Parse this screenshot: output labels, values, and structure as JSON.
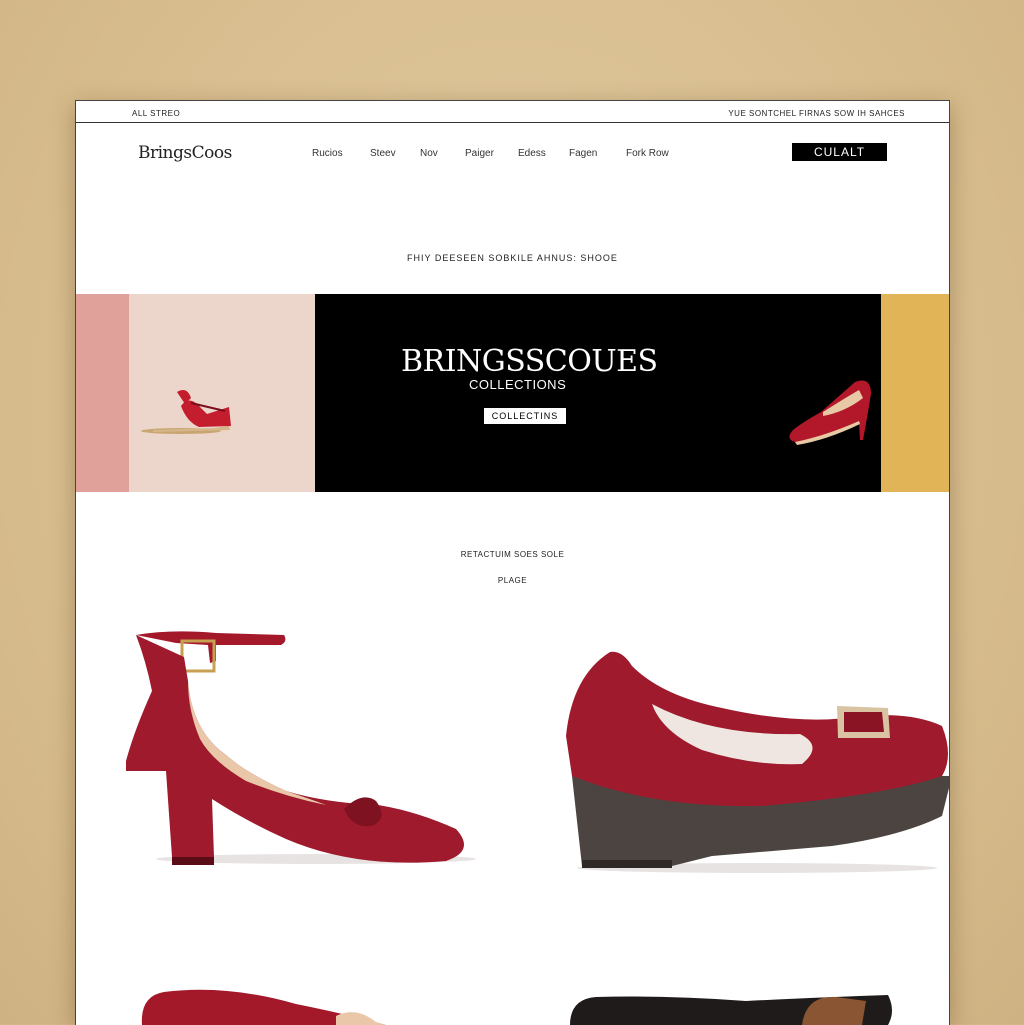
{
  "topbar": {
    "left_text": "ALL STREO",
    "right_text": "YUE SONTCHEL FIRNAS SOW IH SAHCES"
  },
  "header": {
    "logo": "BringsCoos",
    "nav": [
      "Rucios",
      "Steev",
      "Nov",
      "Paiger",
      "Edess",
      "Fagen",
      "Fork Row"
    ],
    "cta_label": "CULALT"
  },
  "tagline": "FHIY DEESEEN SOBKILE AHNUS: SHOOE",
  "hero": {
    "title": "BRINGSSCOUES",
    "subtitle": "COLLECTIONS",
    "button_label": "COLLECTINS"
  },
  "section": {
    "title": "RETACTUIM SOES SOLE",
    "subtitle": "PLAGE"
  },
  "colors": {
    "background": "#d9bf92",
    "hero_pink": "#e0a19b",
    "hero_blush": "#ecd5ca",
    "hero_black": "#000000",
    "hero_mustard": "#e1b457",
    "shoe_red": "#9e1a2c"
  },
  "products": [
    {
      "icon": "red-ankle-strap-heel"
    },
    {
      "icon": "red-platform-loafer"
    },
    {
      "icon": "red-flat"
    },
    {
      "icon": "black-loafer"
    }
  ]
}
